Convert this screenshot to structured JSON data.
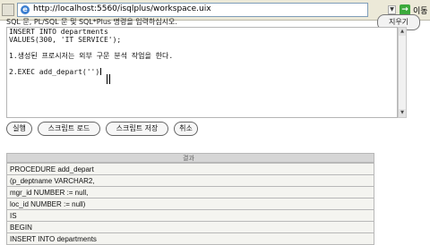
{
  "browser": {
    "url": "http://localhost:5560/isqlplus/workspace.uix",
    "go_label": "이동",
    "dropdown_glyph": "▼",
    "go_glyph": "→",
    "ie_glyph": "e"
  },
  "page": {
    "hint": "SQL 문, PL/SQL 문 및 SQL*Plus 명령을 입력하십시오.",
    "top_right_button": "지우기"
  },
  "editor": {
    "lines": [
      "INSERT INTO departments",
      "VALUES(300, 'IT SERVICE');",
      "",
      "1.생성된 프로시저는 외부 구문 분석 작업을 한다.",
      "",
      "2.EXEC add_depart('')"
    ]
  },
  "buttons": {
    "execute": "실행",
    "load_script": "스크립트 로드",
    "save_script": "스크립트 저장",
    "cancel": "취소"
  },
  "result": {
    "header": "결과",
    "rows": [
      "PROCEDURE add_depart",
      "(p_deptname VARCHAR2,",
      "mgr_id NUMBER := null,",
      "loc_id NUMBER := null)",
      "IS",
      "BEGIN",
      "INSERT INTO departments"
    ]
  }
}
